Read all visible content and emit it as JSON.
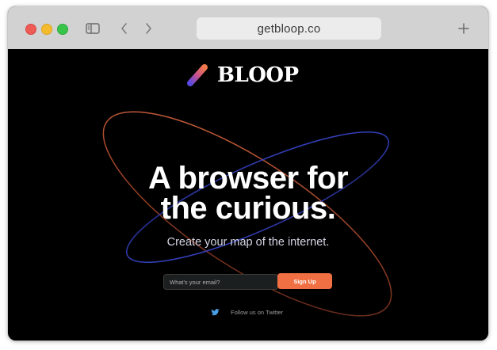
{
  "browser": {
    "url": "getbloop.co",
    "icons": {
      "close": "close-dot",
      "minimize": "minimize-dot",
      "zoom": "zoom-dot",
      "sidebar": "sidebar-icon",
      "back": "chevron-left-icon",
      "forward": "chevron-right-icon",
      "new_tab": "plus-icon"
    },
    "colors": {
      "titlebar": "#d2d2d2",
      "close": "#ee5b55",
      "minimize": "#f5bb2f",
      "zoom": "#38c349"
    }
  },
  "site": {
    "logo": {
      "text": "BLOOP",
      "icon": "bloop-logo-mark"
    },
    "hero": {
      "headline_line1": "A browser for",
      "headline_line2": "the curious.",
      "tagline": "Create your map of the internet."
    },
    "signup": {
      "email_placeholder": "What's your email?",
      "email_value": "",
      "button_label": "Sign Up"
    },
    "social": {
      "twitter_label": "Follow us on Twitter",
      "icon": "twitter-bird-icon"
    },
    "colors": {
      "background": "#000000",
      "accent_orange": "#f06f43",
      "orbit_orange": "#c05a38",
      "orbit_blue": "#3a47c8"
    }
  }
}
